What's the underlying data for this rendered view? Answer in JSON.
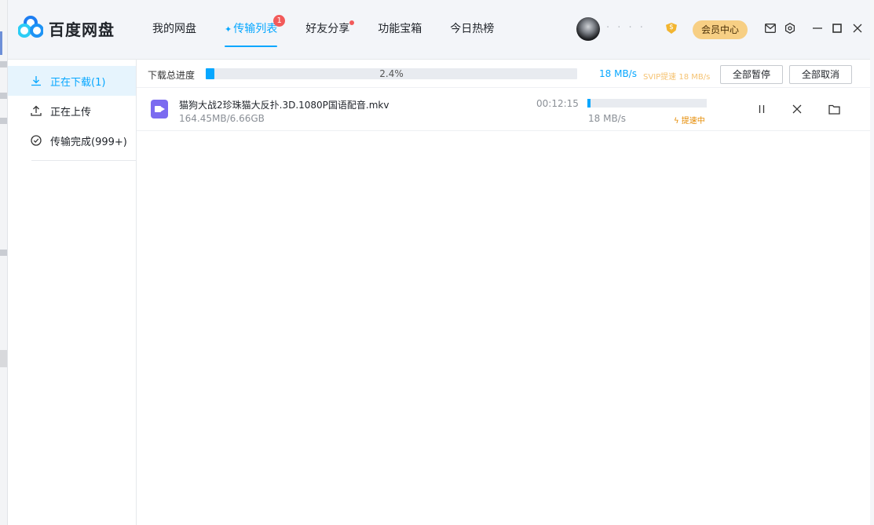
{
  "app": {
    "name": "百度网盘"
  },
  "nav": [
    {
      "label": "我的网盘",
      "active": false
    },
    {
      "label": "传输列表",
      "active": true,
      "badge": "1"
    },
    {
      "label": "好友分享",
      "active": false,
      "dot": true
    },
    {
      "label": "功能宝箱",
      "active": false
    },
    {
      "label": "今日热榜",
      "active": false
    }
  ],
  "header": {
    "username": "· · · ·",
    "vip_badge": "$",
    "vip_button": "会员中心",
    "icons": [
      "mail-icon",
      "settings-icon",
      "minimize-icon",
      "maximize-icon",
      "close-icon"
    ]
  },
  "sidebar": {
    "items": [
      {
        "label": "正在下载(1)",
        "icon": "download-icon",
        "active": true
      },
      {
        "label": "正在上传",
        "icon": "upload-icon",
        "active": false
      },
      {
        "label": "传输完成(999+)",
        "icon": "check-circle-icon",
        "active": false
      }
    ]
  },
  "total": {
    "label": "下载总进度",
    "percent": "2.4%",
    "progress": 0.024,
    "speed": "18 MB/s",
    "svip_speed": "SVIP提速 18 MB/s",
    "pause_all": "全部暂停",
    "cancel_all": "全部取消"
  },
  "downloads": [
    {
      "name": "猫狗大战2珍珠猫大反扑.3D.1080P国语配音.mkv",
      "size": "164.45MB/6.66GB",
      "time_left": "00:12:15",
      "progress": 0.024,
      "speed": "18 MB/s",
      "boost": "提速中"
    }
  ],
  "colors": {
    "accent": "#06a7ff",
    "vip": "#f7cf84",
    "badge": "#f25a5a",
    "boost": "#e58a00"
  }
}
